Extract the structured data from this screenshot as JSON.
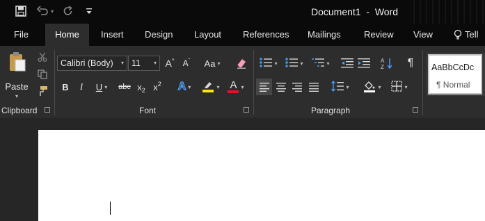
{
  "title_bar": {
    "document_title": "Document1  -  Word",
    "icons": [
      "save-icon",
      "undo-icon",
      "undo-dropdown-icon",
      "redo-icon",
      "customize-qat-icon"
    ]
  },
  "tabs": [
    "File",
    "Home",
    "Insert",
    "Design",
    "Layout",
    "References",
    "Mailings",
    "Review",
    "View"
  ],
  "tell_me": {
    "label": "Tell",
    "icon": "lightbulb-icon"
  },
  "clipboard": {
    "paste_label": "Paste",
    "group_label": "Clipboard"
  },
  "font": {
    "font_name": "Calibri (Body)",
    "font_size": "11",
    "group_label": "Font",
    "change_case_label": "Aa",
    "bold": "B",
    "italic": "I",
    "underline": "U",
    "strikethrough": "abc",
    "subscript_base": "x",
    "subscript_sub": "2",
    "superscript_base": "x",
    "superscript_sup": "2",
    "font_color_letter": "A",
    "grow_letter": "A",
    "shrink_letter": "A",
    "effects_letter": "A"
  },
  "paragraph": {
    "group_label": "Paragraph",
    "pilcrow": "¶"
  },
  "styles": {
    "preview_text": "AaBbCcDc",
    "name": "¶ Normal"
  },
  "colors": {
    "title_bar_bg": "#0a0a0a",
    "ribbon_bg": "#2d2d2d",
    "highlight_yellow": "#ffe600",
    "font_color_red": "#e81123",
    "accent_blue": "#4aa3ff"
  }
}
